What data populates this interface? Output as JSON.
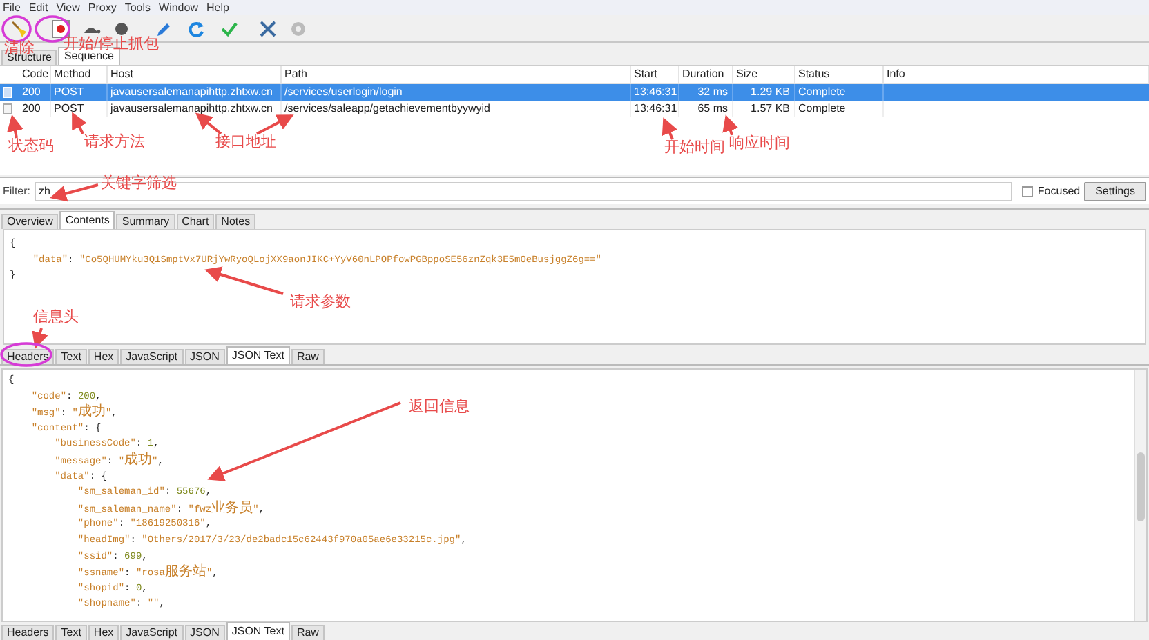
{
  "menu": [
    "File",
    "Edit",
    "View",
    "Proxy",
    "Tools",
    "Window",
    "Help"
  ],
  "session_tabs": [
    {
      "label": "Structure",
      "selected": false
    },
    {
      "label": "Sequence",
      "selected": true
    }
  ],
  "table": {
    "columns": [
      "Code",
      "Method",
      "Host",
      "Path",
      "Start",
      "Duration",
      "Size",
      "Status",
      "Info"
    ],
    "rows": [
      {
        "selected": true,
        "cells": [
          "200",
          "POST",
          "javausersalemanapihttp.zhtxw.cn",
          "/services/userlogin/login",
          "13:46:31",
          "32 ms",
          "1.29 KB",
          "Complete",
          ""
        ]
      },
      {
        "selected": false,
        "cells": [
          "200",
          "POST",
          "javausersalemanapihttp.zhtxw.cn",
          "/services/saleapp/getachievementbyywyid",
          "13:46:31",
          "65 ms",
          "1.57 KB",
          "Complete",
          ""
        ]
      }
    ]
  },
  "filter": {
    "label": "Filter:",
    "value": "zh"
  },
  "focused": {
    "label": "Focused",
    "checked": false
  },
  "settings_button": "Settings",
  "detail_tabs": [
    {
      "label": "Overview",
      "selected": false
    },
    {
      "label": "Contents",
      "selected": true
    },
    {
      "label": "Summary",
      "selected": false
    },
    {
      "label": "Chart",
      "selected": false
    },
    {
      "label": "Notes",
      "selected": false
    }
  ],
  "request_body": [
    "{",
    "    \"data\": \"Co5QHUMYku3Q1SmptVx7URjYwRyoQLojXX9aonJIKC+YyV60nLPOPfowPGBppoSE56znZqk3E5mOeBusjggZ6g==\"",
    "}"
  ],
  "request_tabs": [
    {
      "label": "Headers",
      "selected": false
    },
    {
      "label": "Text",
      "selected": false
    },
    {
      "label": "Hex",
      "selected": false
    },
    {
      "label": "JavaScript",
      "selected": false
    },
    {
      "label": "JSON",
      "selected": false
    },
    {
      "label": "JSON Text",
      "selected": true
    },
    {
      "label": "Raw",
      "selected": false
    }
  ],
  "response_body": [
    "{",
    "    \"code\": 200,",
    "    \"msg\": \"成功\",",
    "    \"content\": {",
    "        \"businessCode\": 1,",
    "        \"message\": \"成功\",",
    "        \"data\": {",
    "            \"sm_saleman_id\": 55676,",
    "            \"sm_saleman_name\": \"fwz业务员\",",
    "            \"phone\": \"18619250316\",",
    "            \"headImg\": \"Others/2017/3/23/de2badc15c62443f970a05ae6e33215c.jpg\",",
    "            \"ssid\": 699,",
    "            \"ssname\": \"rosa服务站\",",
    "            \"shopid\": 0,",
    "            \"shopname\": \"\","
  ],
  "response_tabs": [
    {
      "label": "Headers",
      "selected": false
    },
    {
      "label": "Text",
      "selected": false
    },
    {
      "label": "Hex",
      "selected": false
    },
    {
      "label": "JavaScript",
      "selected": false
    },
    {
      "label": "JSON",
      "selected": false
    },
    {
      "label": "JSON Text",
      "selected": true
    },
    {
      "label": "Raw",
      "selected": false
    }
  ],
  "annotations": [
    "清除",
    "开始/停止抓包",
    "状态码",
    "请求方法",
    "接口地址",
    "开始时间",
    "响应时间",
    "关键字筛选",
    "请求参数",
    "信息头",
    "返回信息"
  ]
}
